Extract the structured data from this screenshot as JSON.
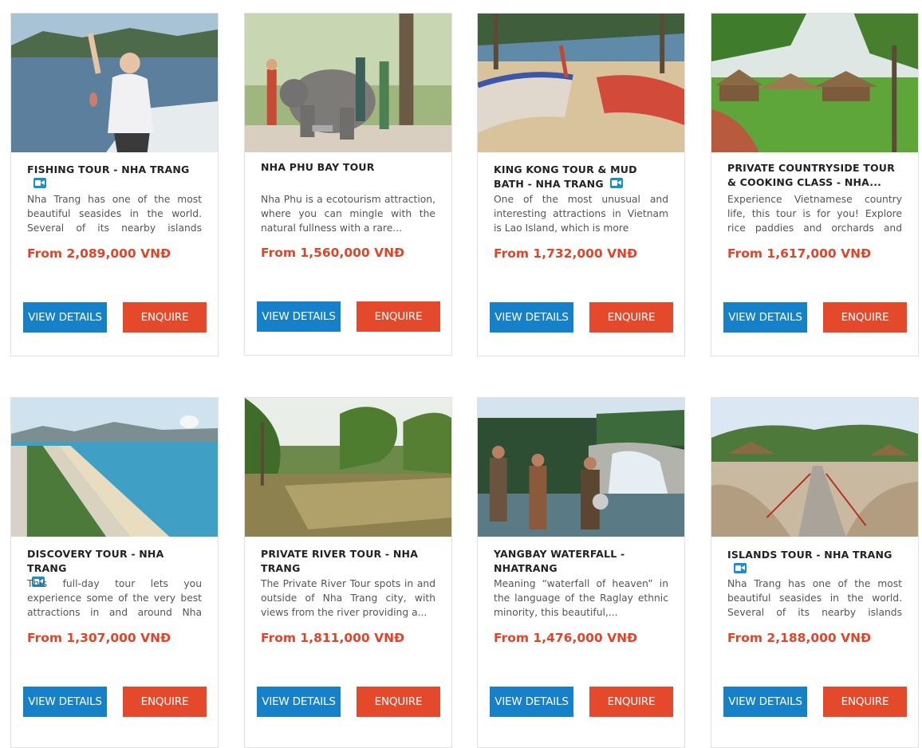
{
  "currency_prefix": "From",
  "buttons": {
    "view": "VIEW DETAILS",
    "enquire": "ENQUIRE"
  },
  "tours": [
    {
      "title": "FISHING TOUR - NHA TRANG",
      "video": true,
      "desc": "Nha Trang has one of the most beautiful seasides in the world. Several of its nearby islands have...",
      "price": "From 2,089,000 VNĐ",
      "image": "fishing-photo"
    },
    {
      "title": "NHA PHU BAY TOUR",
      "video": false,
      "desc": "Nha Phu is a ecotourism attraction, where you can mingle with the natural fullness with a rare...",
      "price": "From 1,560,000 VNĐ",
      "image": "elephant-photo"
    },
    {
      "title": "KING KONG TOUR & MUD BATH - NHA TRANG",
      "video": true,
      "desc": "One of the most unusual and interesting attractions in Vietnam is Lao Island, which is more",
      "price": "From 1,732,000 VNĐ",
      "image": "island-beach-photo"
    },
    {
      "title": "PRIVATE COUNTRYSIDE TOUR & COOKING CLASS - NHA...",
      "video": false,
      "desc": "Experience Vietnamese country life, this tour is for you! Explore rice paddies and orchards and meet...",
      "price": "From 1,617,000 VNĐ",
      "image": "countryside-resort-photo"
    },
    {
      "title": "DISCOVERY TOUR - NHA TRANG",
      "video": true,
      "desc": "This full-day tour lets you experience some of the very best attractions in and around Nha Trang....",
      "price": "From 1,307,000 VNĐ",
      "image": "coastline-photo"
    },
    {
      "title": "PRIVATE RIVER TOUR - NHA TRANG",
      "video": false,
      "desc": "The Private River Tour spots in and outside of Nha Trang city, with views from the river providing a...",
      "price": "From 1,811,000 VNĐ",
      "image": "river-palms-photo"
    },
    {
      "title": "YANGBAY WATERFALL - NHATRANG",
      "video": false,
      "desc": "Meaning “waterfall of heaven” in the language of the Raglay ethnic minority, this beautiful,...",
      "price": "From 1,476,000 VNĐ",
      "image": "waterfall-photo"
    },
    {
      "title": "ISLANDS TOUR - NHA TRANG",
      "video": true,
      "desc": "Nha Trang has one of the most beautiful seasides in the world. Several of its nearby islands have...",
      "price": "From 2,188,000 VNĐ",
      "image": "islands-walkway-photo"
    }
  ],
  "colors": {
    "view_button": "#1681c9",
    "enquire_button": "#e4492b",
    "price": "#e0452a",
    "video_icon": "#1a8fd0"
  }
}
